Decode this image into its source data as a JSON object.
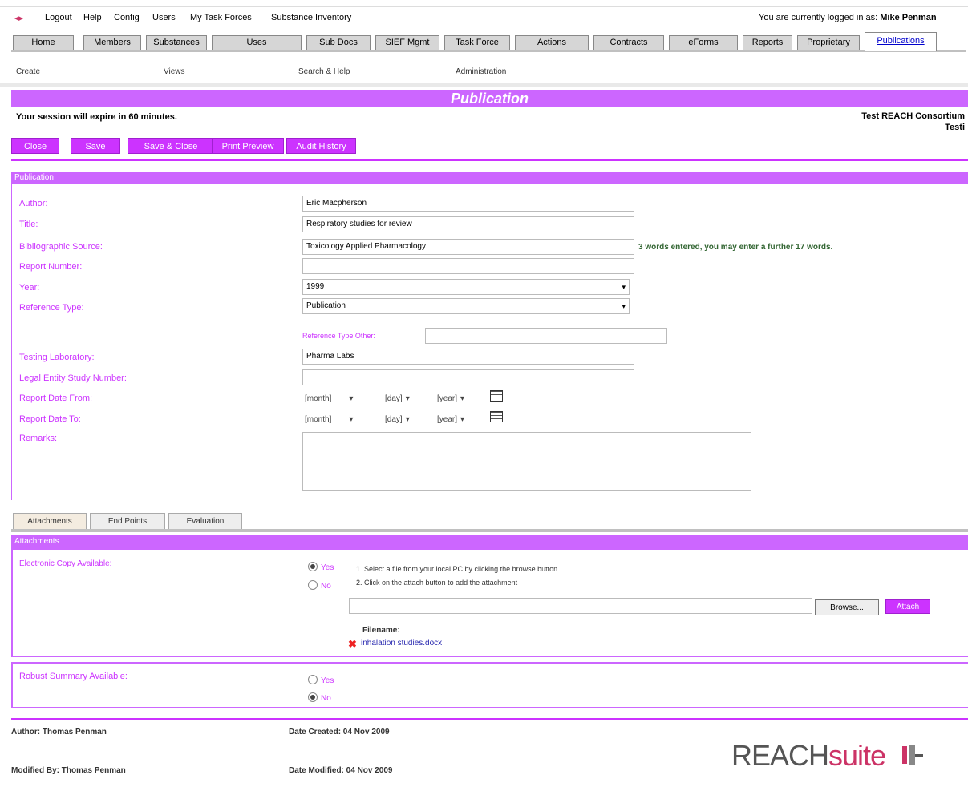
{
  "topnav": {
    "items": [
      "Logout",
      "Help",
      "Config",
      "Users",
      "My Task Forces",
      "Substance Inventory"
    ],
    "logged_in_prefix": "You are currently logged in as",
    "user_name": "Mike Penman"
  },
  "tabs": [
    "Home",
    "Members",
    "Substances",
    "Uses",
    "Sub Docs",
    "SIEF Mgmt",
    "Task Force",
    "Actions",
    "Contracts",
    "eForms",
    "Reports",
    "Proprietary",
    "Publications"
  ],
  "active_tab": "Publications",
  "subnav": [
    "Create",
    "Views",
    "Search & Help",
    "Administration"
  ],
  "banner": "Publication",
  "session_msg": "Your session will expire in 60 minutes.",
  "consortium": {
    "line1": "Test REACH Consortium",
    "line2": "Testi"
  },
  "buttons": [
    "Close",
    "Save",
    "Save & Close",
    "Print Preview",
    "Audit History"
  ],
  "section_title": "Publication",
  "form": {
    "author_label": "Author:",
    "author_value": "Eric Macpherson",
    "title_label": "Title:",
    "title_value": "Respiratory studies for review",
    "source_label": "Bibliographic Source:",
    "source_value": "Toxicology Applied Pharmacology",
    "source_hint": "3 words entered, you may enter a further 17 words.",
    "report_number_label": "Report Number:",
    "report_number_value": "",
    "year_label": "Year:",
    "year_value": "1999",
    "reftype_label": "Reference Type:",
    "reftype_value": "Publication",
    "reftype_other_label": "Reference Type Other:",
    "reftype_other_value": "",
    "lab_label": "Testing Laboratory:",
    "lab_value": "Pharma Labs",
    "legal_label": "Legal Entity Study Number:",
    "legal_value": "",
    "date_from_label": "Report Date From:",
    "date_to_label": "Report Date To:",
    "month_ph": "[month]",
    "day_ph": "[day]",
    "year_ph": "[year]",
    "remarks_label": "Remarks:"
  },
  "subtabs": [
    "Attachments",
    "End Points",
    "Evaluation"
  ],
  "attachments": {
    "header": "Attachments",
    "ecopy_label": "Electronic Copy Available:",
    "yes": "Yes",
    "no": "No",
    "step1": "1. Select a file from your local PC by clicking the browse button",
    "step2": "2. Click on the attach button to add the attachment",
    "browse": "Browse...",
    "attach": "Attach",
    "filename_label": "Filename:",
    "filename": "inhalation studies.docx",
    "robust_label": "Robust Summary Available:"
  },
  "footer": {
    "author": "Author: Thomas Penman",
    "created": "Date Created: 04 Nov 2009",
    "modified_by": "Modified By: Thomas Penman",
    "modified": "Date Modified: 04 Nov 2009"
  },
  "logo": {
    "reach": "REACH",
    "suite": "suite"
  }
}
